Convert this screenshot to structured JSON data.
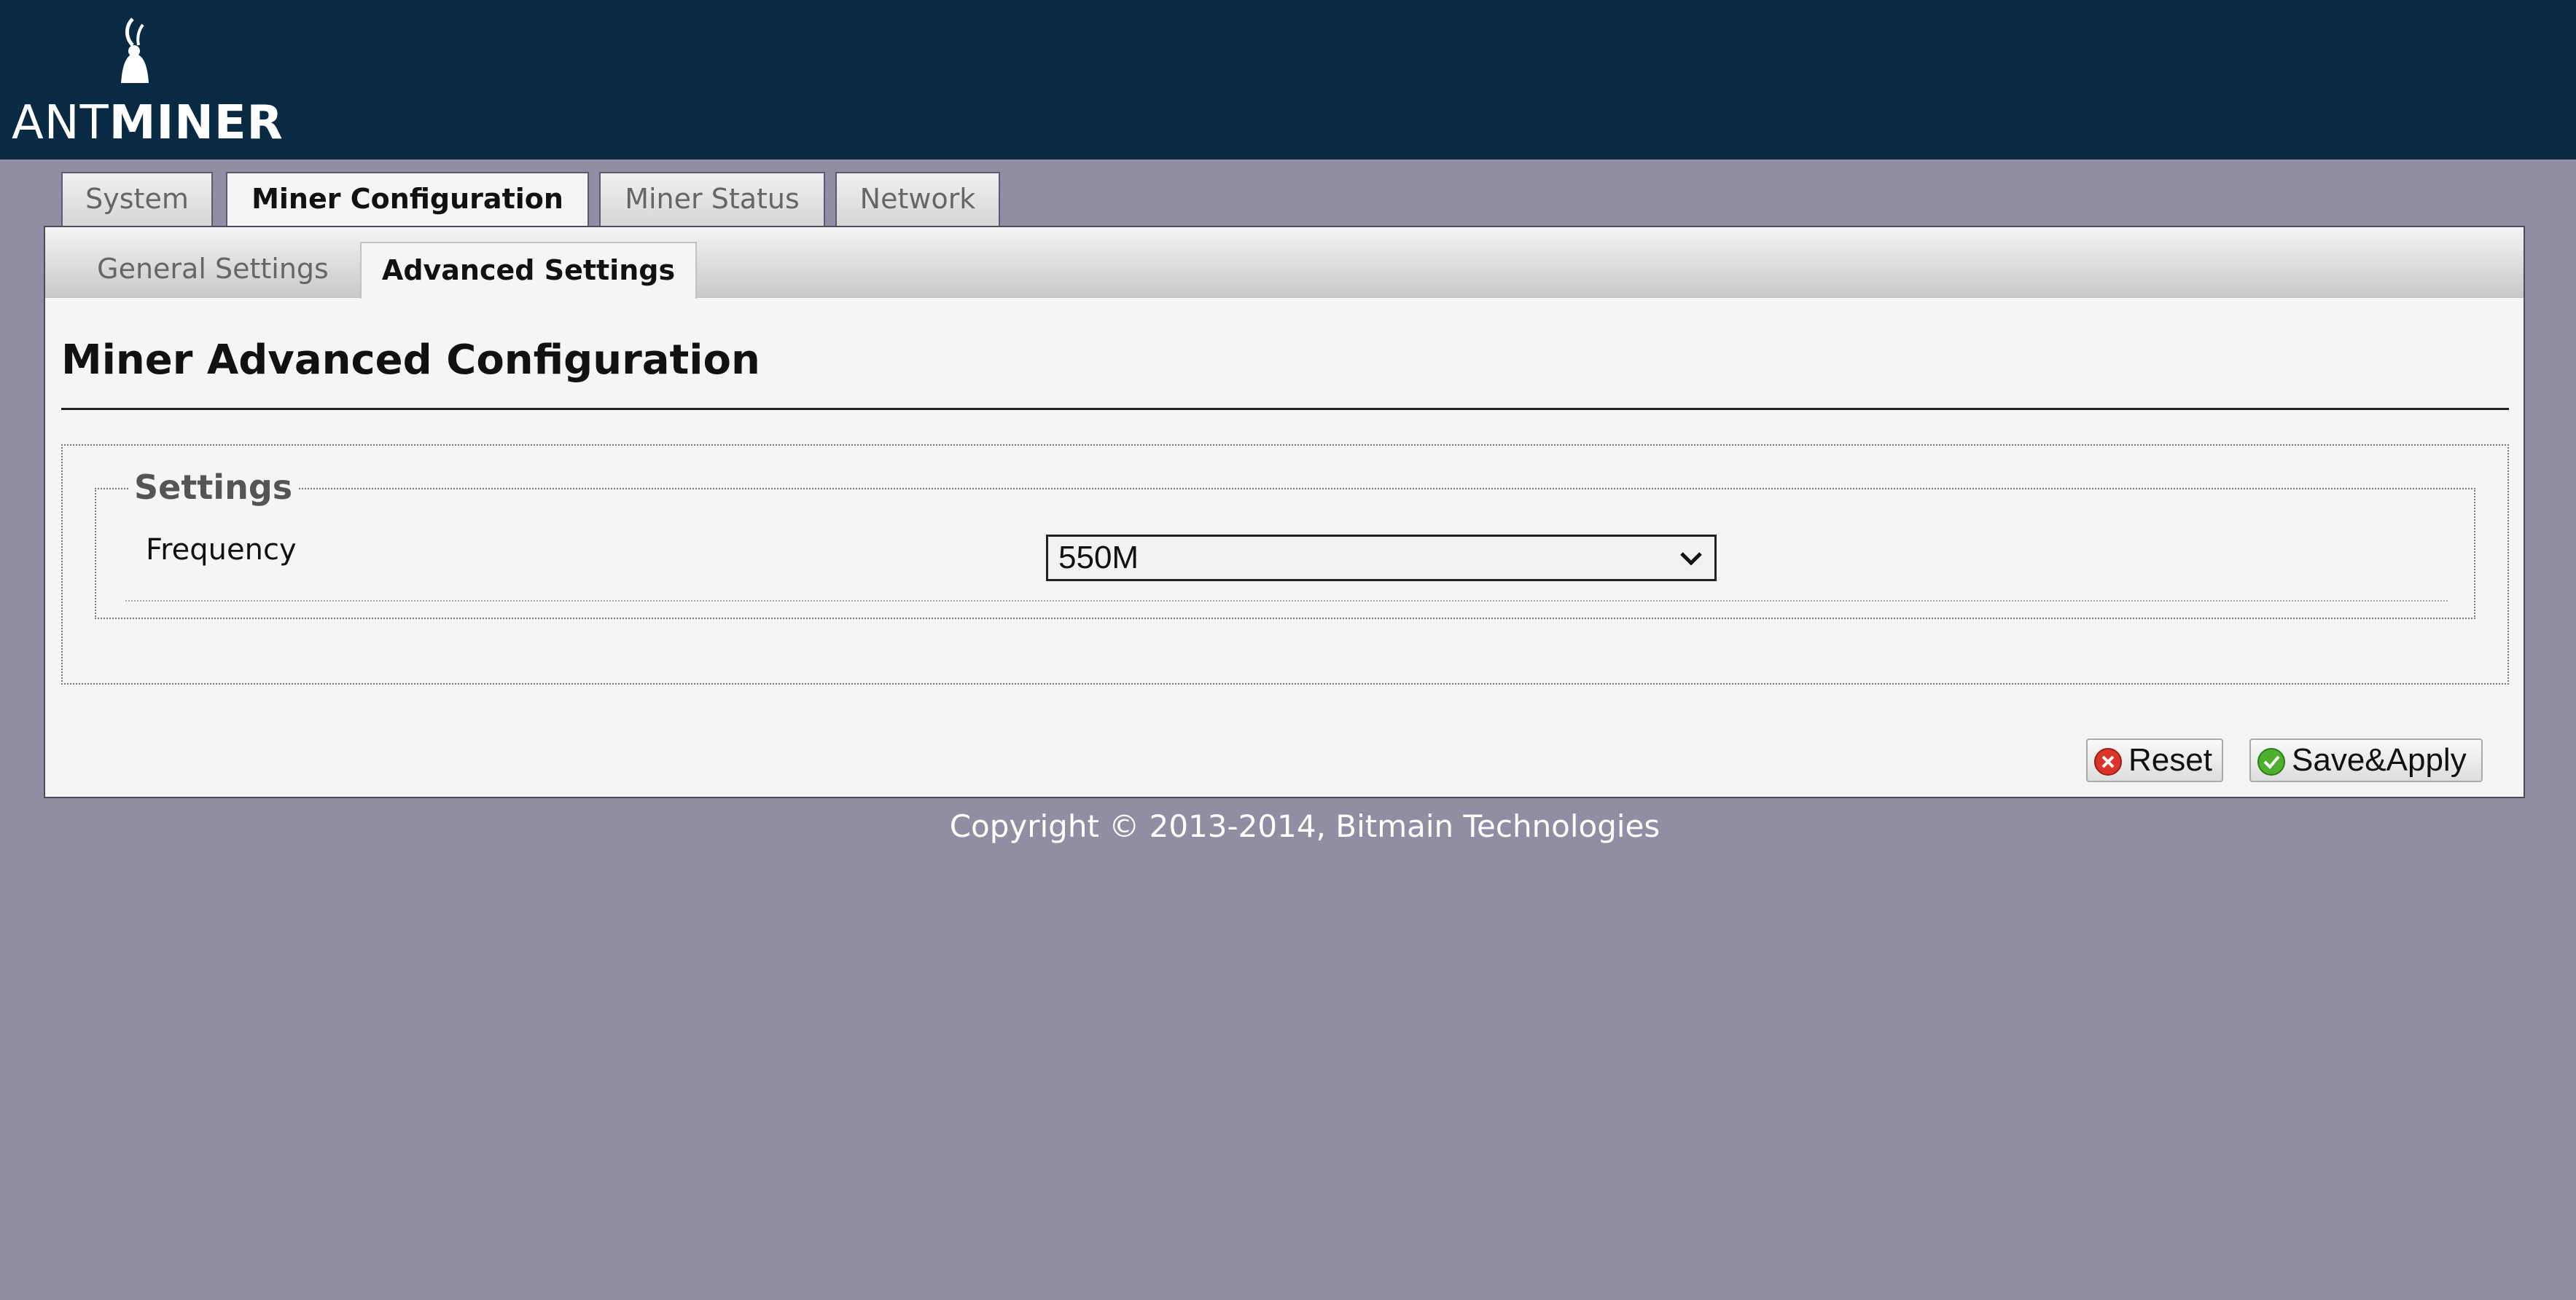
{
  "header": {
    "logo": {
      "part1": "ANT",
      "part2": "MINER"
    }
  },
  "main_tabs": [
    {
      "label": "System",
      "active": false
    },
    {
      "label": "Miner Configuration",
      "active": true
    },
    {
      "label": "Miner Status",
      "active": false
    },
    {
      "label": "Network",
      "active": false
    }
  ],
  "sub_tabs": [
    {
      "label": "General Settings",
      "active": false
    },
    {
      "label": "Advanced Settings",
      "active": true
    }
  ],
  "page": {
    "title": "Miner Advanced Configuration",
    "fieldset_legend": "Settings",
    "frequency": {
      "label": "Frequency",
      "selected": "550M"
    }
  },
  "buttons": {
    "reset": {
      "label": "Reset",
      "icon": "x-circle-icon",
      "color": "#d9352c"
    },
    "save": {
      "label": "Save&Apply",
      "icon": "check-circle-icon",
      "color": "#4caf2e"
    }
  },
  "footer": {
    "copyright": "Copyright © 2013-2014, Bitmain Technologies"
  },
  "colors": {
    "header_bg": "#082a42",
    "page_bg": "#918ea3",
    "panel_bg": "#f5f5f5"
  }
}
